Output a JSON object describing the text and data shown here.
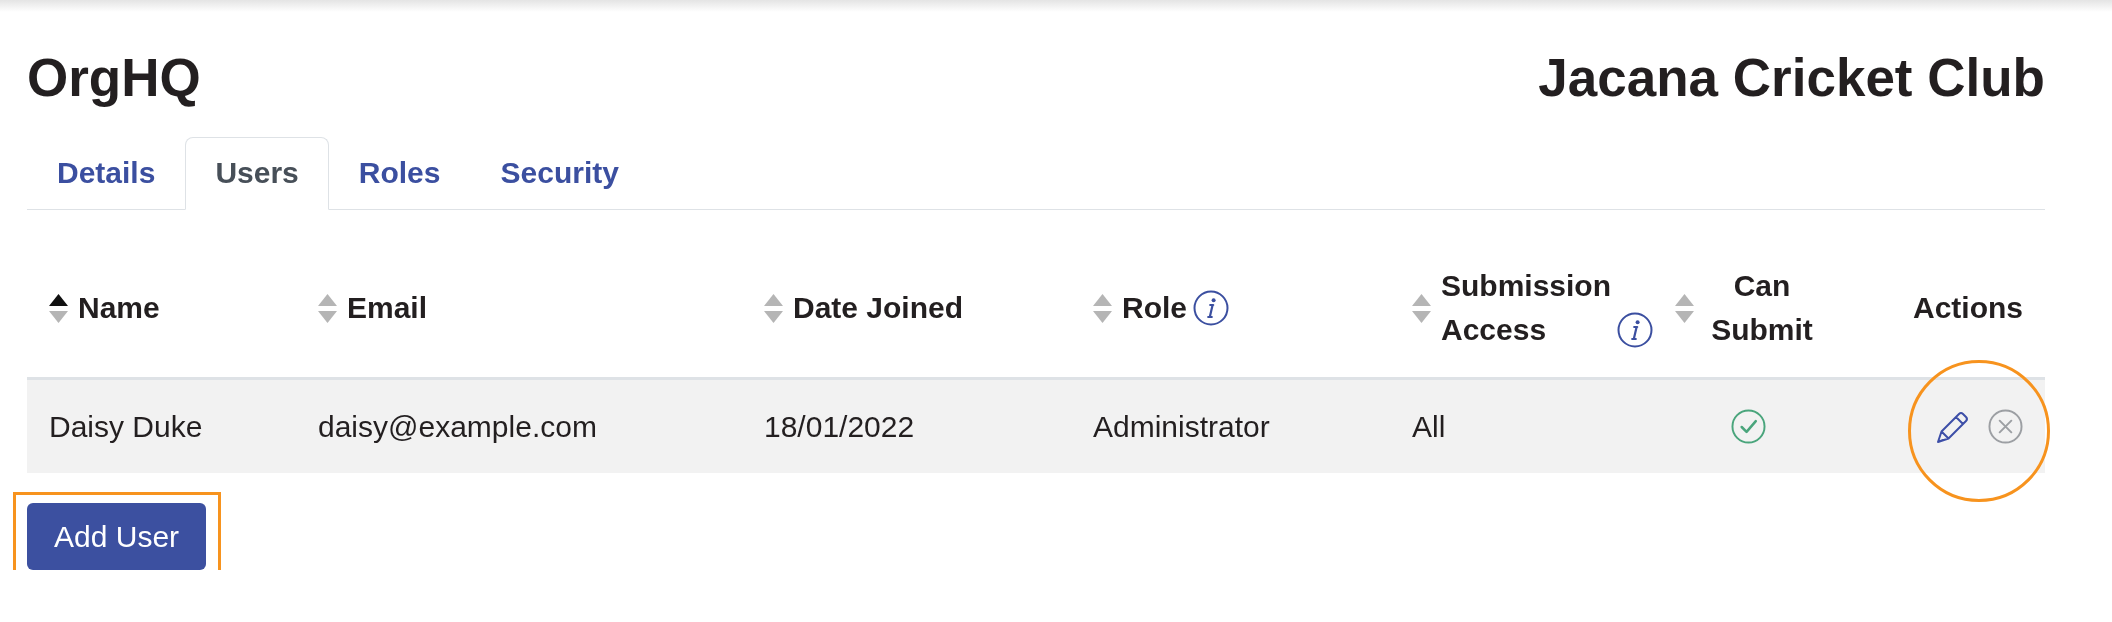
{
  "header": {
    "app_name": "OrgHQ",
    "organisation": "Jacana Cricket Club"
  },
  "tabs": [
    {
      "label": "Details",
      "selected": false
    },
    {
      "label": "Users",
      "selected": true
    },
    {
      "label": "Roles",
      "selected": false
    },
    {
      "label": "Security",
      "selected": false
    }
  ],
  "table": {
    "columns": [
      {
        "label": "Name",
        "kind": "text",
        "sortable": true,
        "sorted": true,
        "info": false
      },
      {
        "label": "Email",
        "kind": "text",
        "sortable": true,
        "sorted": false,
        "info": false
      },
      {
        "label": "Date Joined",
        "kind": "text",
        "sortable": true,
        "sorted": false,
        "info": false
      },
      {
        "label": "Role",
        "kind": "text",
        "sortable": true,
        "sorted": false,
        "info": true
      },
      {
        "label": "Submission Access",
        "kind": "text",
        "sortable": true,
        "sorted": false,
        "info": true
      },
      {
        "label": "Can Submit",
        "kind": "check",
        "sortable": true,
        "sorted": false,
        "info": false
      },
      {
        "label": "Actions",
        "kind": "actions",
        "sortable": false,
        "info": false
      }
    ],
    "rows": [
      {
        "cells": [
          "Daisy Duke",
          "daisy@example.com",
          "18/01/2022",
          "Administrator",
          "All"
        ],
        "can_submit": true,
        "actions_highlighted": true
      }
    ]
  },
  "add_user_button": {
    "label": "Add User",
    "highlighted": true
  }
}
